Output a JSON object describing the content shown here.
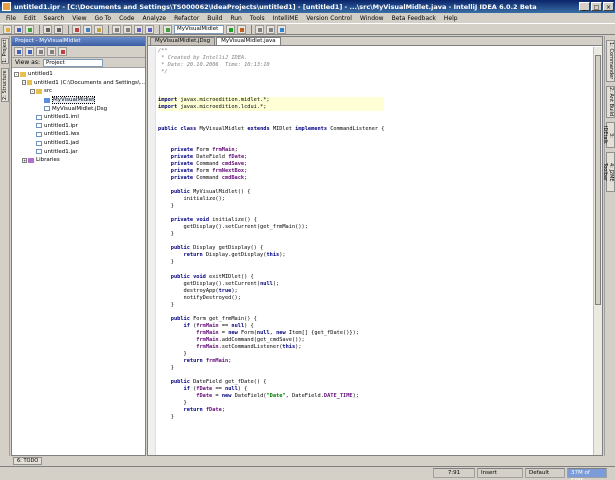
{
  "window": {
    "title": "untitled1.ipr - [C:\\Documents and Settings\\TS000062\\IdeaProjects\\untitled1] - [untitled1] - ...\\src\\MyVisualMidlet.java - IntelliJ IDEA 6.0.2 Beta",
    "minimize": "_",
    "maximize": "□",
    "close": "×"
  },
  "menu": [
    "File",
    "Edit",
    "Search",
    "View",
    "Go To",
    "Code",
    "Analyze",
    "Refactor",
    "Build",
    "Run",
    "Tools",
    "IntelliME",
    "Version Control",
    "Window",
    "Beta Feedback",
    "Help"
  ],
  "toolbar": {
    "run_config": "MyVisualMidlet"
  },
  "left_strip": {
    "project_tab": "1: Project",
    "structure_tab": "2: Structure"
  },
  "right_strip": [
    "1: Commander",
    "2: Ant Build",
    "3: IDEtalk",
    "4: J2ME Toolbar"
  ],
  "project_panel": {
    "header": "Project - MyVisualMidlet",
    "view_label": "View as:",
    "view_value": "Project",
    "tree": [
      {
        "label": "untitled1",
        "indent": 0,
        "icon": "folder",
        "expander": "-"
      },
      {
        "label": "untitled1  (C:\\Documents and Settings\\...",
        "indent": 1,
        "icon": "folder",
        "expander": "-"
      },
      {
        "label": "src",
        "indent": 2,
        "icon": "folder",
        "expander": "-"
      },
      {
        "label": "MyVisualMidlet",
        "indent": 3,
        "icon": "java",
        "expander": "",
        "selected": true
      },
      {
        "label": "MyVisualMidlet.jDsg",
        "indent": 3,
        "icon": "file",
        "expander": ""
      },
      {
        "label": "untitled1.iml",
        "indent": 2,
        "icon": "file",
        "expander": ""
      },
      {
        "label": "untitled1.ipr",
        "indent": 2,
        "icon": "file",
        "expander": ""
      },
      {
        "label": "untitled1.iws",
        "indent": 2,
        "icon": "file",
        "expander": ""
      },
      {
        "label": "untitled1.jad",
        "indent": 2,
        "icon": "file",
        "expander": ""
      },
      {
        "label": "untitled1.jar",
        "indent": 2,
        "icon": "file",
        "expander": ""
      },
      {
        "label": "Libraries",
        "indent": 1,
        "icon": "lib",
        "expander": "+"
      }
    ]
  },
  "editor": {
    "tabs": [
      {
        "label": "MyVisualMidlet.jDsg",
        "active": false
      },
      {
        "label": "MyVisualMidlet.java",
        "active": true
      }
    ],
    "lines": [
      [
        [
          "c-comment",
          "/**"
        ]
      ],
      [
        [
          "c-comment",
          " * Created by IntelliJ IDEA."
        ]
      ],
      [
        [
          "c-comment",
          " * Date: 20.10.2006  Time: 10:13:10"
        ]
      ],
      [
        [
          "c-comment",
          " */"
        ]
      ],
      [],
      [],
      [],
      [
        [
          "c-kw",
          "import"
        ],
        [
          "c-import",
          " javax.microedition.midlet.*;"
        ]
      ],
      [
        [
          "c-kw",
          "import"
        ],
        [
          "c-import",
          " javax.microedition.lcdui.*;"
        ]
      ],
      [],
      [],
      [
        [
          "c-kw",
          "public class"
        ],
        [
          "",
          " MyVisualMidlet "
        ],
        [
          "c-kw",
          "extends"
        ],
        [
          "",
          " MIDlet "
        ],
        [
          "c-kw",
          "implements"
        ],
        [
          "",
          " CommandListener {"
        ]
      ],
      [],
      [],
      [
        [
          "",
          "    "
        ],
        [
          "c-kw",
          "private"
        ],
        [
          "",
          " Form "
        ],
        [
          "c-field",
          "frmMain"
        ],
        [
          "",
          ";"
        ]
      ],
      [
        [
          "",
          "    "
        ],
        [
          "c-kw",
          "private"
        ],
        [
          "",
          " DateField "
        ],
        [
          "c-field",
          "fDate"
        ],
        [
          "",
          ";"
        ]
      ],
      [
        [
          "",
          "    "
        ],
        [
          "c-kw",
          "private"
        ],
        [
          "",
          " Command "
        ],
        [
          "c-field",
          "cmdSave"
        ],
        [
          "",
          ";"
        ]
      ],
      [
        [
          "",
          "    "
        ],
        [
          "c-kw",
          "private"
        ],
        [
          "",
          " Form "
        ],
        [
          "c-field",
          "frmNextBox"
        ],
        [
          "",
          ";"
        ]
      ],
      [
        [
          "",
          "    "
        ],
        [
          "c-kw",
          "private"
        ],
        [
          "",
          " Command "
        ],
        [
          "c-field",
          "cmdBack"
        ],
        [
          "",
          ";"
        ]
      ],
      [],
      [
        [
          "",
          "    "
        ],
        [
          "c-kw",
          "public"
        ],
        [
          "",
          " MyVisualMidlet() {"
        ]
      ],
      [
        [
          "",
          "        initialize();"
        ]
      ],
      [
        [
          "",
          "    }"
        ]
      ],
      [],
      [
        [
          "",
          "    "
        ],
        [
          "c-kw",
          "private void"
        ],
        [
          "",
          " initialize() {"
        ]
      ],
      [
        [
          "",
          "        getDisplay().setCurrent(get_frmMain());"
        ]
      ],
      [
        [
          "",
          "    }"
        ]
      ],
      [],
      [
        [
          "",
          "    "
        ],
        [
          "c-kw",
          "public"
        ],
        [
          "",
          " Display getDisplay() {"
        ]
      ],
      [
        [
          "",
          "        "
        ],
        [
          "c-kw",
          "return"
        ],
        [
          "",
          " Display.getDisplay("
        ],
        [
          "c-kw",
          "this"
        ],
        [
          "",
          ");"
        ]
      ],
      [
        [
          "",
          "    }"
        ]
      ],
      [],
      [
        [
          "",
          "    "
        ],
        [
          "c-kw",
          "public void"
        ],
        [
          "",
          " exitMIDlet() {"
        ]
      ],
      [
        [
          "",
          "        getDisplay().setCurrent("
        ],
        [
          "c-kw",
          "null"
        ],
        [
          "",
          ");"
        ]
      ],
      [
        [
          "",
          "        destroyApp("
        ],
        [
          "c-kw",
          "true"
        ],
        [
          "",
          ");"
        ]
      ],
      [
        [
          "",
          "        notifyDestroyed();"
        ]
      ],
      [
        [
          "",
          "    }"
        ]
      ],
      [],
      [
        [
          "",
          "    "
        ],
        [
          "c-kw",
          "public"
        ],
        [
          "",
          " Form get_frmMain() {"
        ]
      ],
      [
        [
          "",
          "        "
        ],
        [
          "c-kw",
          "if"
        ],
        [
          "",
          " ("
        ],
        [
          "c-field",
          "frmMain"
        ],
        [
          "",
          " == "
        ],
        [
          "c-kw",
          "null"
        ],
        [
          "",
          ") {"
        ]
      ],
      [
        [
          "",
          "            "
        ],
        [
          "c-field",
          "frmMain"
        ],
        [
          "",
          " = "
        ],
        [
          "c-kw",
          "new"
        ],
        [
          "",
          " Form("
        ],
        [
          "c-kw",
          "null"
        ],
        [
          "",
          ", "
        ],
        [
          "c-kw",
          "new"
        ],
        [
          "",
          " Item[] {get_fDate()});"
        ]
      ],
      [
        [
          "",
          "            "
        ],
        [
          "c-field",
          "frmMain"
        ],
        [
          "",
          ".addCommand(get_cmdSave());"
        ]
      ],
      [
        [
          "",
          "            "
        ],
        [
          "c-field",
          "frmMain"
        ],
        [
          "",
          ".setCommandListener("
        ],
        [
          "c-kw",
          "this"
        ],
        [
          "",
          ");"
        ]
      ],
      [
        [
          "",
          "        }"
        ]
      ],
      [
        [
          "",
          "        "
        ],
        [
          "c-kw",
          "return"
        ],
        [
          "",
          " "
        ],
        [
          "c-field",
          "frmMain"
        ],
        [
          "",
          ";"
        ]
      ],
      [
        [
          "",
          "    }"
        ]
      ],
      [],
      [
        [
          "",
          "    "
        ],
        [
          "c-kw",
          "public"
        ],
        [
          "",
          " DateField get_fDate() {"
        ]
      ],
      [
        [
          "",
          "        "
        ],
        [
          "c-kw",
          "if"
        ],
        [
          "",
          " ("
        ],
        [
          "c-field",
          "fDate"
        ],
        [
          "",
          " == "
        ],
        [
          "c-kw",
          "null"
        ],
        [
          "",
          ") {"
        ]
      ],
      [
        [
          "",
          "            "
        ],
        [
          "c-field",
          "fDate"
        ],
        [
          "",
          " = "
        ],
        [
          "c-kw",
          "new"
        ],
        [
          "",
          " DateField("
        ],
        [
          "c-str",
          "\"Date\""
        ],
        [
          "",
          ", DateField."
        ],
        [
          "c-field",
          "DATE_TIME"
        ],
        [
          "",
          ");"
        ]
      ],
      [
        [
          "",
          "        }"
        ]
      ],
      [
        [
          "",
          "        "
        ],
        [
          "c-kw",
          "return"
        ],
        [
          "",
          " "
        ],
        [
          "c-field",
          "fDate"
        ],
        [
          "",
          ";"
        ]
      ],
      [
        [
          "",
          "    }"
        ]
      ]
    ]
  },
  "bottom_tabs": [
    "6: TODO"
  ],
  "status": {
    "position": "7:91",
    "mode": "Insert",
    "scheme": "Default",
    "memory": "37M of 59M"
  }
}
